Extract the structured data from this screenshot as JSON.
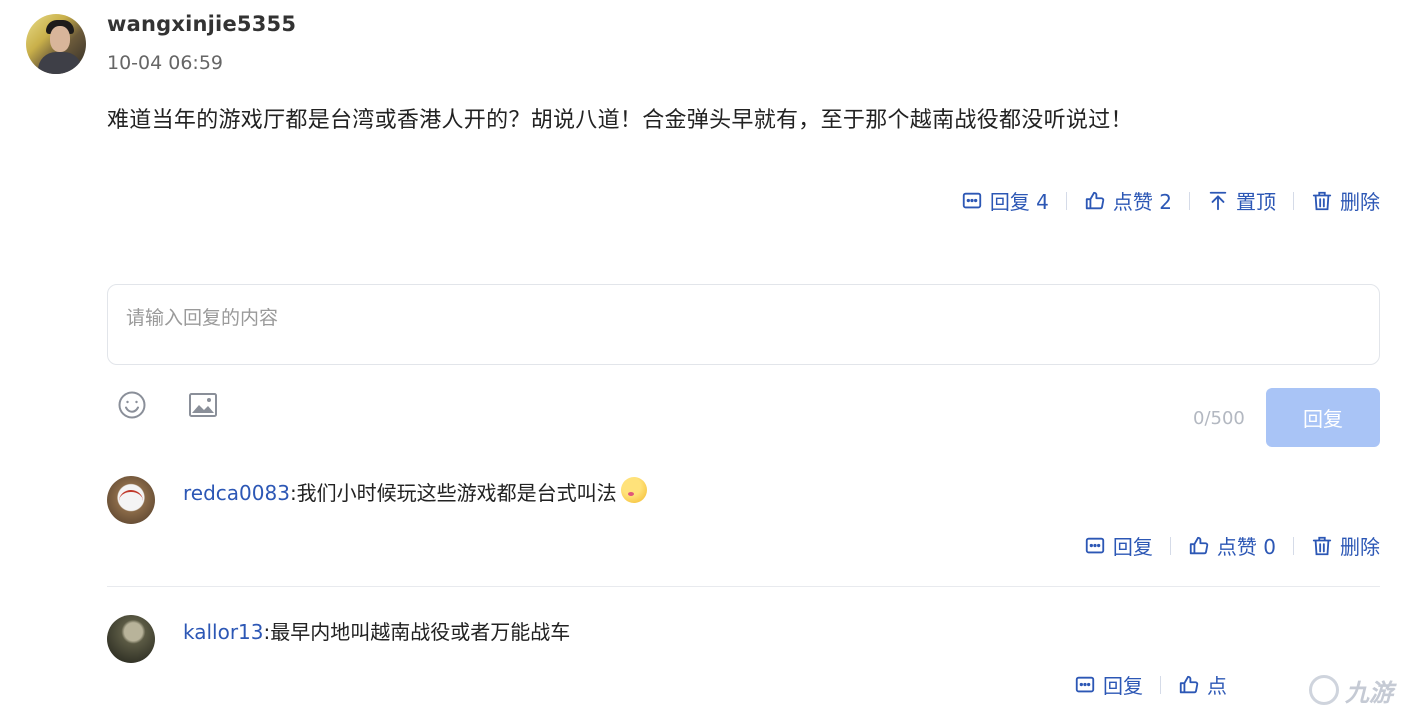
{
  "comment": {
    "username": "wangxinjie5355",
    "time": "10-04 06:59",
    "content": "难道当年的游戏厅都是台湾或香港人开的？胡说八道！合金弹头早就有，至于那个越南战役都没听说过！",
    "actions": {
      "reply_label": "回复 4",
      "like_label": "点赞 2",
      "pin_label": "置顶",
      "delete_label": "删除"
    }
  },
  "reply_form": {
    "placeholder": "请输入回复的内容",
    "value": "",
    "counter": "0/500",
    "submit_label": "回复"
  },
  "replies": [
    {
      "username": "redca0083",
      "text": ":我们小时候玩这些游戏都是台式叫法",
      "reply_label": "回复",
      "like_label": "点赞 0",
      "delete_label": "删除"
    },
    {
      "username": "kallor13",
      "text": ":最早内地叫越南战役或者万能战车",
      "reply_label": "回复",
      "like_label": "点"
    }
  ],
  "watermark": {
    "text": "九游"
  },
  "colors": {
    "accent": "#2c57b5",
    "button_disabled": "#a9c4f6"
  }
}
